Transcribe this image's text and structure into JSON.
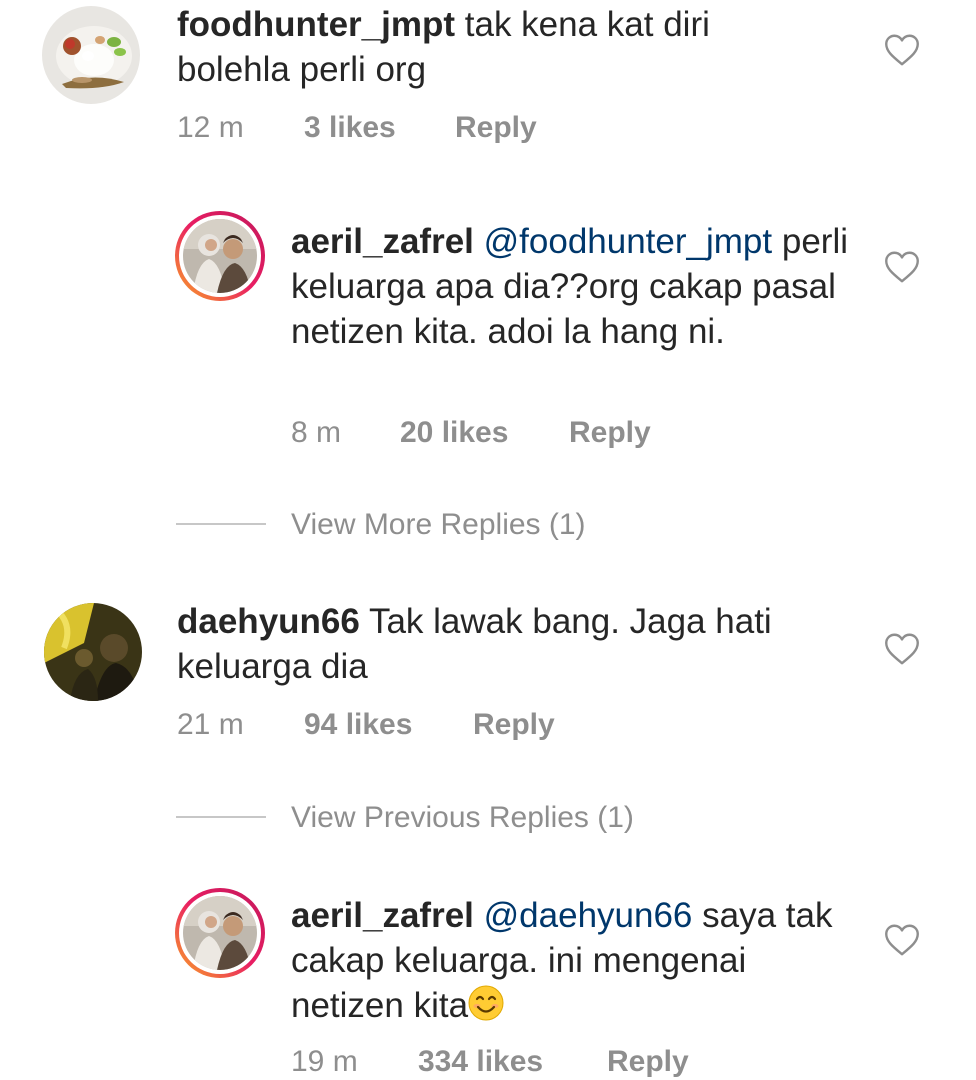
{
  "comments": [
    {
      "username": "foodhunter_jmpt",
      "mention": "",
      "text": "tak kena kat diri bolehla perli org",
      "time": "12 m",
      "likes": "3 likes",
      "reply": "Reply"
    },
    {
      "username": "aeril_zafrel",
      "mention": "@foodhunter_jmpt",
      "text": "perli keluarga apa dia??org cakap pasal netizen kita. adoi la hang ni.",
      "time": "8 m",
      "likes": "20 likes",
      "reply": "Reply"
    },
    {
      "username": "daehyun66",
      "mention": "",
      "text": "Tak lawak bang. Jaga hati keluarga dia",
      "time": "21 m",
      "likes": "94 likes",
      "reply": "Reply"
    },
    {
      "username": "aeril_zafrel",
      "mention": "@daehyun66",
      "text": "saya tak cakap keluarga. ini mengenai netizen kita",
      "time": "19 m",
      "likes": "334 likes",
      "reply": "Reply"
    }
  ],
  "view_more_replies": "View More Replies (1)",
  "view_previous_replies": "View Previous Replies (1)",
  "icons": {
    "heart": "heart-outline-icon",
    "emoji": "smiling-face-emoji"
  },
  "colors": {
    "text": "#262626",
    "secondary": "#8e8e8e",
    "mention": "#00376b",
    "story_ring_start": "#f9a825",
    "story_ring_end": "#c2185b"
  }
}
